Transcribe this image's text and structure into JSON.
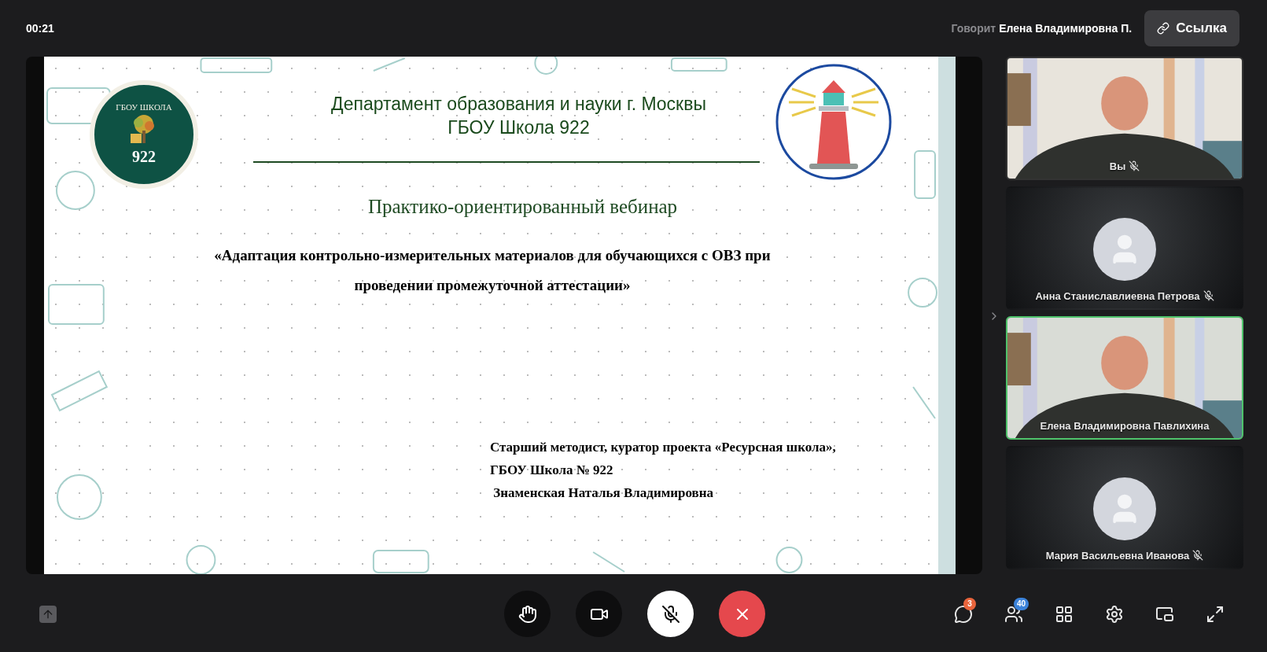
{
  "top_bar": {
    "timer": "00:21",
    "speaker_label": "Говорит",
    "speaker_name": "Елена Владимировна П.",
    "link_button": "Ссылка"
  },
  "slide": {
    "logo": {
      "title": "ГБОУ ШКОЛА",
      "number": "922"
    },
    "heading": [
      "Департамент образования и науки г. Москвы",
      "ГБОУ Школа 922"
    ],
    "subtitle": "Практико-ориентированный вебинар",
    "topic": "«Адаптация контрольно-измерительных материалов для обучающихся с ОВЗ при проведении промежуточной аттестации»",
    "author": [
      "Старший методист, куратор проекта «Ресурсная школа»,",
      "ГБОУ Школа № 922",
      " Знаменская Наталья Владимировна"
    ]
  },
  "participants": [
    {
      "name": "Вы",
      "kind": "video",
      "muted": true,
      "speaking": false
    },
    {
      "name": "Анна Станиславлиевна Петрова",
      "kind": "avatar",
      "muted": true,
      "speaking": false
    },
    {
      "name": "Елена Владимировна Павлихина",
      "kind": "video",
      "muted": false,
      "speaking": true
    },
    {
      "name": "Мария Васильевна Иванова",
      "kind": "avatar",
      "muted": true,
      "speaking": false
    }
  ],
  "controls": [
    {
      "kind": "hand",
      "on": false
    },
    {
      "kind": "camera",
      "on": false
    },
    {
      "kind": "mic",
      "on": true
    },
    {
      "kind": "leave"
    }
  ],
  "tools": [
    {
      "kind": "chat",
      "badge": "3"
    },
    {
      "kind": "people",
      "badge": "40"
    },
    {
      "kind": "grid"
    },
    {
      "kind": "settings"
    },
    {
      "kind": "pip"
    },
    {
      "kind": "fullscreen"
    }
  ]
}
